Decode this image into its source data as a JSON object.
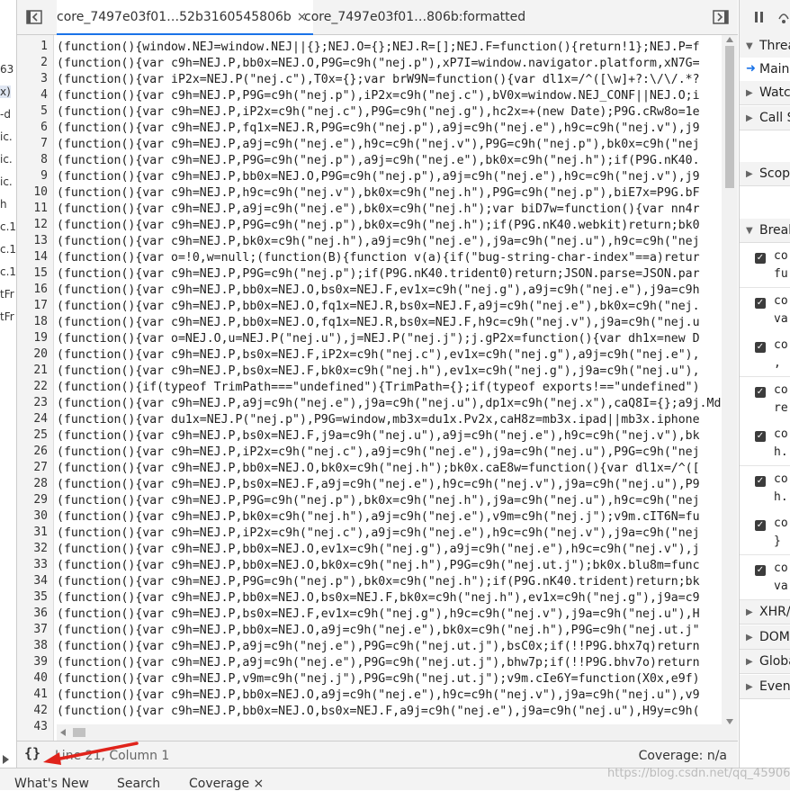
{
  "left_panel": {
    "fragments": [
      "63",
      "x)",
      "-d",
      "ic.",
      "ic.",
      "ic.",
      "h",
      "c.1",
      "c.1",
      "c.1",
      "tFr",
      "tFr"
    ]
  },
  "tabs": [
    {
      "label": "core_7497e03f01…52b3160545806b",
      "close": "×",
      "active": true
    },
    {
      "label": "core_7497e03f01…806b:formatted",
      "active": false
    }
  ],
  "code_lines": [
    "(function(){window.NEJ=window.NEJ||{};NEJ.O={};NEJ.R=[];NEJ.F=function(){return!1};NEJ.P=f",
    "(function(){var c9h=NEJ.P,bb0x=NEJ.O,P9G=c9h(\"nej.p\"),xP7I=window.navigator.platform,xN7G=",
    "(function(){var iP2x=NEJ.P(\"nej.c\"),T0x={};var brW9N=function(){var dl1x=/^([\\w]+?:\\/\\/.*?",
    "(function(){var c9h=NEJ.P,P9G=c9h(\"nej.p\"),iP2x=c9h(\"nej.c\"),bV0x=window.NEJ_CONF||NEJ.O;i",
    "(function(){var c9h=NEJ.P,iP2x=c9h(\"nej.c\"),P9G=c9h(\"nej.g\"),hc2x=+(new Date);P9G.cRw8o=1e",
    "(function(){var c9h=NEJ.P,fq1x=NEJ.R,P9G=c9h(\"nej.p\"),a9j=c9h(\"nej.e\"),h9c=c9h(\"nej.v\"),j9",
    "(function(){var c9h=NEJ.P,a9j=c9h(\"nej.e\"),h9c=c9h(\"nej.v\"),P9G=c9h(\"nej.p\"),bk0x=c9h(\"nej",
    "(function(){var c9h=NEJ.P,P9G=c9h(\"nej.p\"),a9j=c9h(\"nej.e\"),bk0x=c9h(\"nej.h\");if(P9G.nK40.",
    "(function(){var c9h=NEJ.P,bb0x=NEJ.O,P9G=c9h(\"nej.p\"),a9j=c9h(\"nej.e\"),h9c=c9h(\"nej.v\"),j9",
    "(function(){var c9h=NEJ.P,h9c=c9h(\"nej.v\"),bk0x=c9h(\"nej.h\"),P9G=c9h(\"nej.p\"),biE7x=P9G.bF",
    "(function(){var c9h=NEJ.P,a9j=c9h(\"nej.e\"),bk0x=c9h(\"nej.h\");var biD7w=function(){var nn4r",
    "(function(){var c9h=NEJ.P,P9G=c9h(\"nej.p\"),bk0x=c9h(\"nej.h\");if(P9G.nK40.webkit)return;bk0",
    "(function(){var c9h=NEJ.P,bk0x=c9h(\"nej.h\"),a9j=c9h(\"nej.e\"),j9a=c9h(\"nej.u\"),h9c=c9h(\"nej",
    "(function(){var o=!0,w=null;(function(B){function v(a){if(\"bug-string-char-index\"==a)retur",
    "(function(){var c9h=NEJ.P,P9G=c9h(\"nej.p\");if(P9G.nK40.trident0)return;JSON.parse=JSON.par",
    "(function(){var c9h=NEJ.P,bb0x=NEJ.O,bs0x=NEJ.F,ev1x=c9h(\"nej.g\"),a9j=c9h(\"nej.e\"),j9a=c9h",
    "(function(){var c9h=NEJ.P,bb0x=NEJ.O,fq1x=NEJ.R,bs0x=NEJ.F,a9j=c9h(\"nej.e\"),bk0x=c9h(\"nej.",
    "(function(){var c9h=NEJ.P,bb0x=NEJ.O,fq1x=NEJ.R,bs0x=NEJ.F,h9c=c9h(\"nej.v\"),j9a=c9h(\"nej.u",
    "(function(){var o=NEJ.O,u=NEJ.P(\"nej.u\"),j=NEJ.P(\"nej.j\");j.gP2x=function(){var dh1x=new D",
    "(function(){var c9h=NEJ.P,bs0x=NEJ.F,iP2x=c9h(\"nej.c\"),ev1x=c9h(\"nej.g\"),a9j=c9h(\"nej.e\"),",
    "(function(){var c9h=NEJ.P,bs0x=NEJ.F,bk0x=c9h(\"nej.h\"),ev1x=c9h(\"nej.g\"),j9a=c9h(\"nej.u\"),",
    "(function(){if(typeof TrimPath===\"undefined\"){TrimPath={};if(typeof exports!==\"undefined\")",
    "(function(){var c9h=NEJ.P,a9j=c9h(\"nej.e\"),j9a=c9h(\"nej.u\"),dp1x=c9h(\"nej.x\"),caQ8I={};a9j.Md1x=Trim",
    "(function(){var du1x=NEJ.P(\"nej.p\"),P9G=window,mb3x=du1x.Pv2x,caH8z=mb3x.ipad||mb3x.iphone",
    "(function(){var c9h=NEJ.P,bs0x=NEJ.F,j9a=c9h(\"nej.u\"),a9j=c9h(\"nej.e\"),h9c=c9h(\"nej.v\"),bk",
    "(function(){var c9h=NEJ.P,iP2x=c9h(\"nej.c\"),a9j=c9h(\"nej.e\"),j9a=c9h(\"nej.u\"),P9G=c9h(\"nej",
    "(function(){var c9h=NEJ.P,bb0x=NEJ.O,bk0x=c9h(\"nej.h\");bk0x.caE8w=function(){var dl1x=/^([",
    "(function(){var c9h=NEJ.P,bs0x=NEJ.F,a9j=c9h(\"nej.e\"),h9c=c9h(\"nej.v\"),j9a=c9h(\"nej.u\"),P9",
    "(function(){var c9h=NEJ.P,P9G=c9h(\"nej.p\"),bk0x=c9h(\"nej.h\"),j9a=c9h(\"nej.u\"),h9c=c9h(\"nej",
    "(function(){var c9h=NEJ.P,bk0x=c9h(\"nej.h\"),a9j=c9h(\"nej.e\"),v9m=c9h(\"nej.j\");v9m.cIT6N=fu",
    "(function(){var c9h=NEJ.P,iP2x=c9h(\"nej.c\"),a9j=c9h(\"nej.e\"),h9c=c9h(\"nej.v\"),j9a=c9h(\"nej",
    "(function(){var c9h=NEJ.P,bb0x=NEJ.O,ev1x=c9h(\"nej.g\"),a9j=c9h(\"nej.e\"),h9c=c9h(\"nej.v\"),j",
    "(function(){var c9h=NEJ.P,bb0x=NEJ.O,bk0x=c9h(\"nej.h\"),P9G=c9h(\"nej.ut.j\");bk0x.blu8m=func",
    "(function(){var c9h=NEJ.P,P9G=c9h(\"nej.p\"),bk0x=c9h(\"nej.h\");if(P9G.nK40.trident)return;bk",
    "(function(){var c9h=NEJ.P,bb0x=NEJ.O,bs0x=NEJ.F,bk0x=c9h(\"nej.h\"),ev1x=c9h(\"nej.g\"),j9a=c9",
    "(function(){var c9h=NEJ.P,bs0x=NEJ.F,ev1x=c9h(\"nej.g\"),h9c=c9h(\"nej.v\"),j9a=c9h(\"nej.u\"),H",
    "(function(){var c9h=NEJ.P,bb0x=NEJ.O,a9j=c9h(\"nej.e\"),bk0x=c9h(\"nej.h\"),P9G=c9h(\"nej.ut.j\"",
    "(function(){var c9h=NEJ.P,a9j=c9h(\"nej.e\"),P9G=c9h(\"nej.ut.j\"),bsC0x;if(!!P9G.bhx7q)return",
    "(function(){var c9h=NEJ.P,a9j=c9h(\"nej.e\"),P9G=c9h(\"nej.ut.j\"),bhw7p;if(!!P9G.bhv7o)return",
    "(function(){var c9h=NEJ.P,v9m=c9h(\"nej.j\"),P9G=c9h(\"nej.ut.j\");v9m.cIe6Y=function(X0x,e9f)",
    "(function(){var c9h=NEJ.P,bb0x=NEJ.O,a9j=c9h(\"nej.e\"),h9c=c9h(\"nej.v\"),j9a=c9h(\"nej.u\"),v9",
    "(function(){var c9h=NEJ.P,bb0x=NEJ.O,bs0x=NEJ.F,a9j=c9h(\"nej.e\"),j9a=c9h(\"nej.u\"),H9y=c9h(",
    ""
  ],
  "status": {
    "pretty_print_label": "{}",
    "line_info": "Line 21, Column 1",
    "coverage": "Coverage: n/a"
  },
  "drawer_tabs": [
    {
      "label": "What's New"
    },
    {
      "label": "Search"
    },
    {
      "label": "Coverage",
      "close": "×"
    }
  ],
  "watermark": "https://blog.csdn.net/qq_45906219",
  "right_panel": {
    "sections": [
      {
        "label": "Threa",
        "expanded": true
      },
      {
        "label": "Main",
        "is_item": true
      },
      {
        "label": "Watc",
        "expanded": false
      },
      {
        "label": "Call S",
        "expanded": false
      },
      {
        "label": "Scop",
        "expanded": false
      },
      {
        "label": "Break",
        "expanded": true
      }
    ],
    "breakpoints": [
      {
        "line1": "co",
        "line2": "fu"
      },
      {
        "line1": "co",
        "line2": "va"
      },
      {
        "line1": "co",
        "line2": ","
      },
      {
        "line1": "co",
        "line2": "re"
      },
      {
        "line1": "co",
        "line2": "h."
      },
      {
        "line1": "co",
        "line2": "h."
      },
      {
        "line1": "co",
        "line2": "}"
      },
      {
        "line1": "co",
        "line2": "va"
      }
    ],
    "bottom_sections": [
      {
        "label": "XHR/"
      },
      {
        "label": "DOM"
      },
      {
        "label": "Globa"
      },
      {
        "label": "Event"
      }
    ]
  },
  "colors": {
    "accent": "#1a73e8",
    "arrow": "#e0231b",
    "toolbar_bg": "#f3f3f3"
  }
}
